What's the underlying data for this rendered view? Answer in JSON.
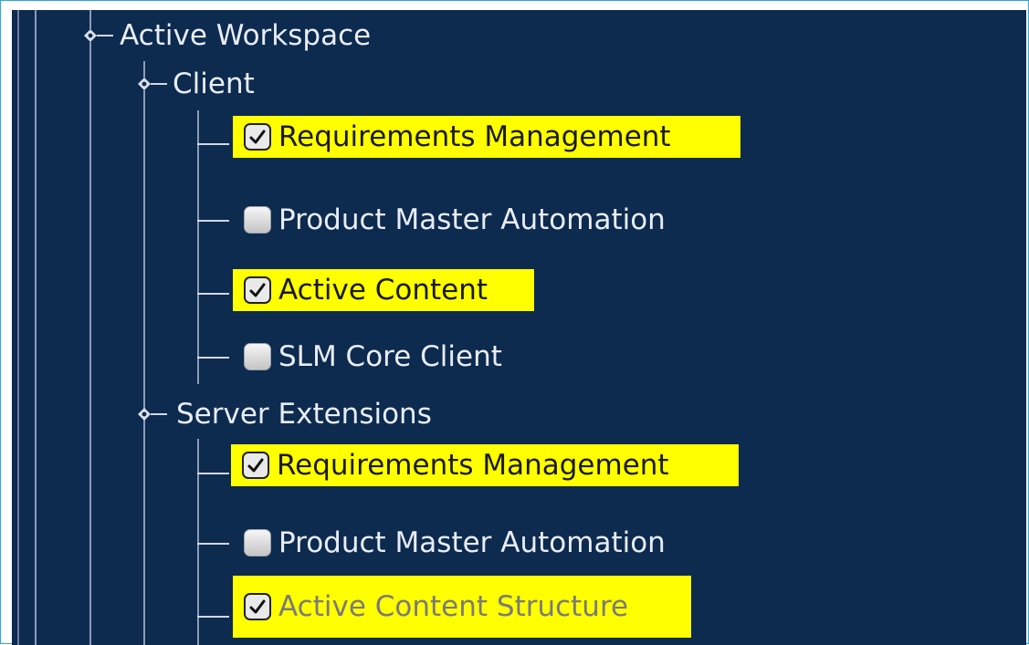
{
  "tree": {
    "root": {
      "label": "Active Workspace",
      "icon": "node-expand-icon"
    },
    "groups": [
      {
        "label": "Client",
        "icon": "node-expand-icon",
        "items": [
          {
            "label": "Requirements Management",
            "checked": true,
            "highlighted": true
          },
          {
            "label": "Product Master Automation",
            "checked": false,
            "highlighted": false
          },
          {
            "label": "Active Content",
            "checked": true,
            "highlighted": true
          },
          {
            "label": "SLM Core Client",
            "checked": false,
            "highlighted": false
          }
        ]
      },
      {
        "label": "Server Extensions",
        "icon": "node-expand-icon",
        "items": [
          {
            "label": "Requirements Management",
            "checked": true,
            "highlighted": true
          },
          {
            "label": "Product Master Automation",
            "checked": false,
            "highlighted": false
          },
          {
            "label": "Active Content Structure",
            "checked": true,
            "highlighted": true,
            "dimmed": true
          }
        ]
      }
    ]
  },
  "colors": {
    "background": "#0d2a4f",
    "highlight": "#ffff00",
    "frame_border": "#2aa7d8",
    "text": "#e8edf6"
  }
}
